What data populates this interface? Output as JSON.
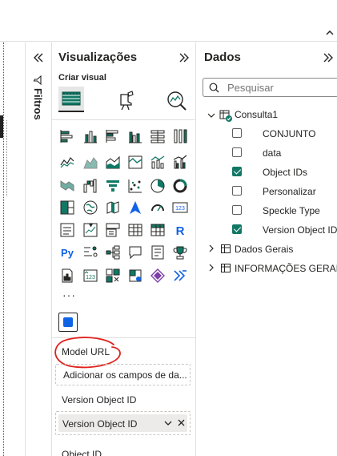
{
  "visualizations": {
    "title": "Visualizações",
    "subtitle": "Criar visual",
    "more": "···"
  },
  "filters": {
    "label": "Filtros"
  },
  "wells": {
    "model_url_label": "Model URL",
    "model_url_placeholder": "Adicionar os campos de da...",
    "version_label": "Version Object ID",
    "version_value": "Version Object ID",
    "object_id_label": "Object ID"
  },
  "data_pane": {
    "title": "Dados",
    "search_placeholder": "Pesquisar",
    "tables": [
      {
        "name": "Consulta1",
        "expanded": true,
        "fields": [
          {
            "name": "CONJUNTO",
            "checked": false
          },
          {
            "name": "data",
            "checked": false
          },
          {
            "name": "Object IDs",
            "checked": true
          },
          {
            "name": "Personalizar",
            "checked": false
          },
          {
            "name": "Speckle Type",
            "checked": false
          },
          {
            "name": "Version Object ID",
            "checked": true
          }
        ]
      },
      {
        "name": "Dados Gerais",
        "expanded": false
      },
      {
        "name": "INFORMAÇÕES GERAIS",
        "expanded": false
      }
    ]
  },
  "colors": {
    "accent_teal": "#117865",
    "selected_visual_blue": "#1163e6",
    "annotation_red": "#e0211b"
  }
}
